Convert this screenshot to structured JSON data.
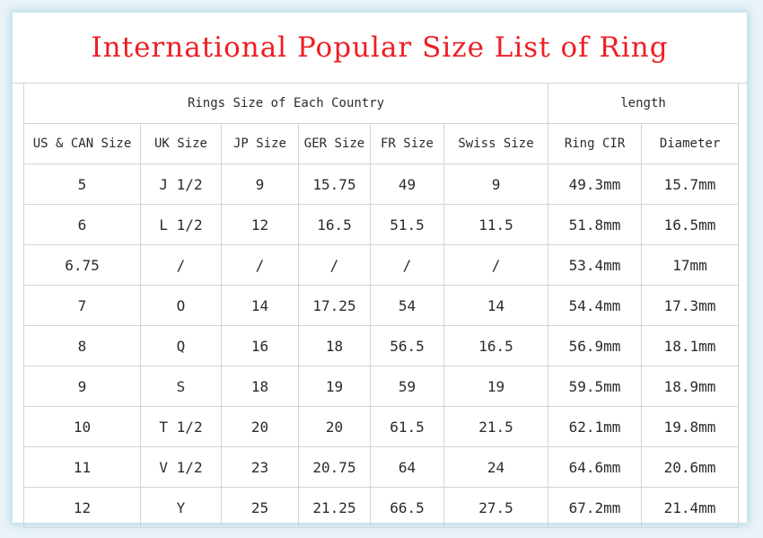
{
  "title": "International Popular Size List of Ring",
  "group_headers": {
    "country": "Rings Size of Each Country",
    "length": "length"
  },
  "columns": [
    "US & CAN Size",
    "UK Size",
    "JP Size",
    "GER Size",
    "FR Size",
    "Swiss Size",
    "Ring CIR",
    "Diameter"
  ],
  "rows": [
    [
      "5",
      "J 1/2",
      "9",
      "15.75",
      "49",
      "9",
      "49.3mm",
      "15.7mm"
    ],
    [
      "6",
      "L 1/2",
      "12",
      "16.5",
      "51.5",
      "11.5",
      "51.8mm",
      "16.5mm"
    ],
    [
      "6.75",
      "/",
      "/",
      "/",
      "/",
      "/",
      "53.4mm",
      "17mm"
    ],
    [
      "7",
      "O",
      "14",
      "17.25",
      "54",
      "14",
      "54.4mm",
      "17.3mm"
    ],
    [
      "8",
      "Q",
      "16",
      "18",
      "56.5",
      "16.5",
      "56.9mm",
      "18.1mm"
    ],
    [
      "9",
      "S",
      "18",
      "19",
      "59",
      "19",
      "59.5mm",
      "18.9mm"
    ],
    [
      "10",
      "T 1/2",
      "20",
      "20",
      "61.5",
      "21.5",
      "62.1mm",
      "19.8mm"
    ],
    [
      "11",
      "V 1/2",
      "23",
      "20.75",
      "64",
      "24",
      "64.6mm",
      "20.6mm"
    ],
    [
      "12",
      "Y",
      "25",
      "21.25",
      "66.5",
      "27.5",
      "67.2mm",
      "21.4mm"
    ]
  ]
}
